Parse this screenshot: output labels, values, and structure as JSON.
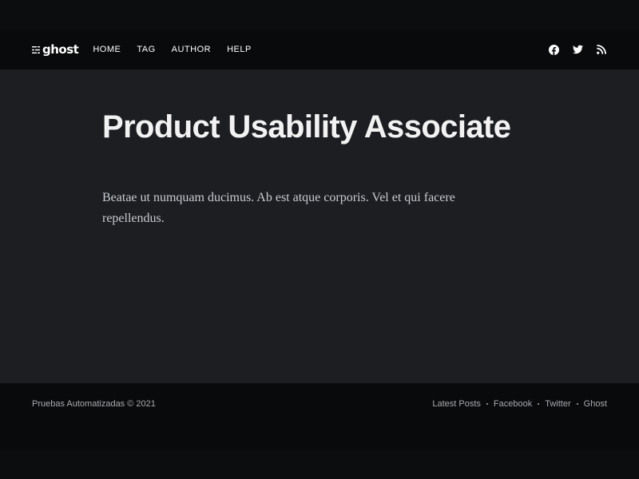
{
  "header": {
    "logo_text": "ghost",
    "nav": [
      {
        "label": "HOME"
      },
      {
        "label": "TAG"
      },
      {
        "label": "AUTHOR"
      },
      {
        "label": "HELP"
      }
    ],
    "social_icons": [
      "facebook-icon",
      "twitter-icon",
      "rss-icon"
    ]
  },
  "article": {
    "title": "Product Usability Associate",
    "body": "Beatae ut numquam ducimus. Ab est atque corporis. Vel et qui facere repellendus."
  },
  "footer": {
    "copyright": "Pruebas Automatizadas © 2021",
    "links": [
      {
        "label": "Latest Posts"
      },
      {
        "label": "Facebook"
      },
      {
        "label": "Twitter"
      },
      {
        "label": "Ghost"
      }
    ]
  },
  "colors": {
    "header_bg": "#090a0b",
    "main_bg": "#1c1e22",
    "title": "#f2f2f2",
    "body_text": "#c8cbd0",
    "footer_text": "#a8abb0"
  }
}
